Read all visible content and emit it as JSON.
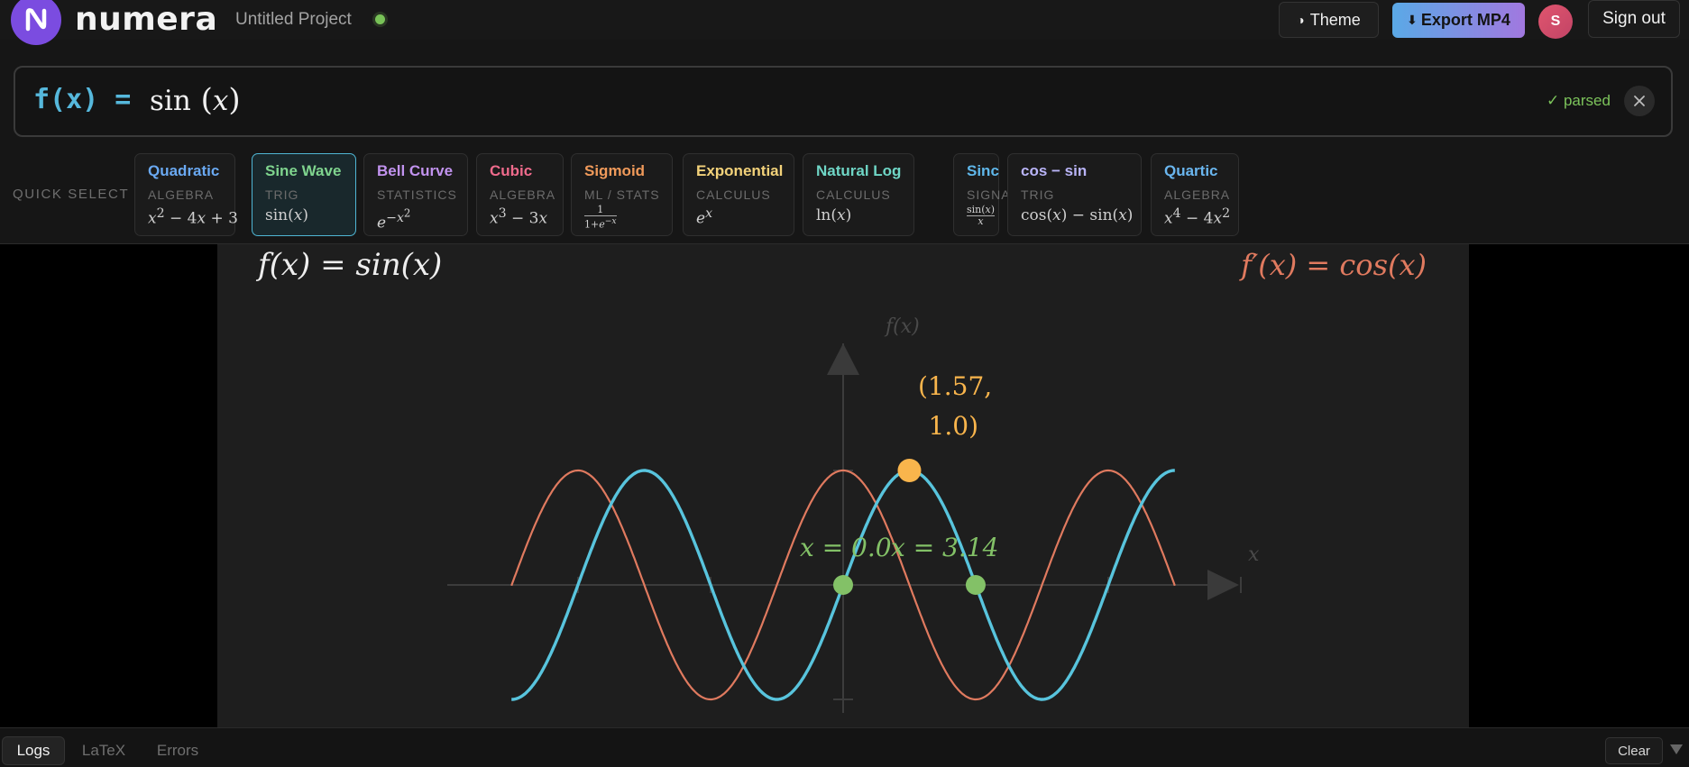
{
  "header": {
    "brand": "numera",
    "project_title": "Untitled Project",
    "theme_label": "Theme",
    "theme_icon": "◑",
    "export_label": "Export MP4",
    "export_icon": "⬇",
    "avatar_initial": "S",
    "signout_label": "Sign out",
    "status_color": "#78c257"
  },
  "formula": {
    "label": "f(x) =",
    "expression_fn": "sin",
    "expression_arg": "x",
    "status": "✓ parsed"
  },
  "quick_select": {
    "label": "QUICK SELECT",
    "items": [
      {
        "name": "Quadratic",
        "category": "ALGEBRA",
        "color": "#6aa9f2",
        "expr_html": "<i>x</i><sup>2</sup> − 4<i>x</i> + 3"
      },
      {
        "name": "Sine Wave",
        "category": "TRIG",
        "color": "#7fd48e",
        "expr_html": "sin(<i>x</i>)",
        "active": true
      },
      {
        "name": "Bell Curve",
        "category": "STATISTICS",
        "color": "#c293ef",
        "expr_html": "<i>e</i><sup>−<i>x</i><sup>2</sup></sup>"
      },
      {
        "name": "Cubic",
        "category": "ALGEBRA",
        "color": "#ef6b8c",
        "expr_html": "<i>x</i><sup>3</sup> − 3<i>x</i>"
      },
      {
        "name": "Sigmoid",
        "category": "ML / STATS",
        "color": "#f09a5a",
        "expr_html": "<u style='text-decoration:none;border-bottom:1px solid #aaa;display:block'>1</u>1+<i>e</i><sup>−<i>x</i></sup>"
      },
      {
        "name": "Exponential",
        "category": "CALCULUS",
        "color": "#f3d27a",
        "expr_html": "<i>e</i><sup><i>x</i></sup>"
      },
      {
        "name": "Natural Log",
        "category": "CALCULUS",
        "color": "#6fd6c6",
        "expr_html": "ln(<i>x</i>)"
      },
      {
        "name": "Sinc",
        "category": "SIGNAL",
        "color": "#5fb7ea",
        "expr_html": "<u style='text-decoration:none;border-bottom:1px solid #aaa;display:block'>sin(<i>x</i>)</u><i>x</i>"
      },
      {
        "name": "cos − sin",
        "category": "TRIG",
        "color": "#b9b4f7",
        "expr_html": "cos(<i>x</i>) − sin(<i>x</i>)"
      },
      {
        "name": "Quartic",
        "category": "ALGEBRA",
        "color": "#6ab6ef",
        "expr_html": "<i>x</i><sup>4</sup> − 4<i>x</i><sup>2</sup>"
      }
    ]
  },
  "plot": {
    "title_fn": "f(x) = sin(x)",
    "title_derivative": "f′(x) = cos(x)",
    "y_axis_label": "f(x)",
    "x_axis_label": "x",
    "extremum_label_line1": "(1.57,",
    "extremum_label_line2": "1.0)",
    "root_label_1": "x = 0.0",
    "root_label_2": "x = 3.14",
    "fn_color": "#58c4dd",
    "derivative_color": "#e07a5f",
    "extremum_color": "#f9b54c",
    "root_color": "#83c167",
    "x_range": [
      -6,
      6
    ],
    "y_range": [
      -1,
      1
    ],
    "extremum": {
      "x": 1.57,
      "y": 1.0
    },
    "roots": [
      0.0,
      3.14
    ]
  },
  "logbar": {
    "tabs": [
      "Logs",
      "LaTeX",
      "Errors"
    ],
    "active_tab": "Logs",
    "clear_label": "Clear"
  }
}
